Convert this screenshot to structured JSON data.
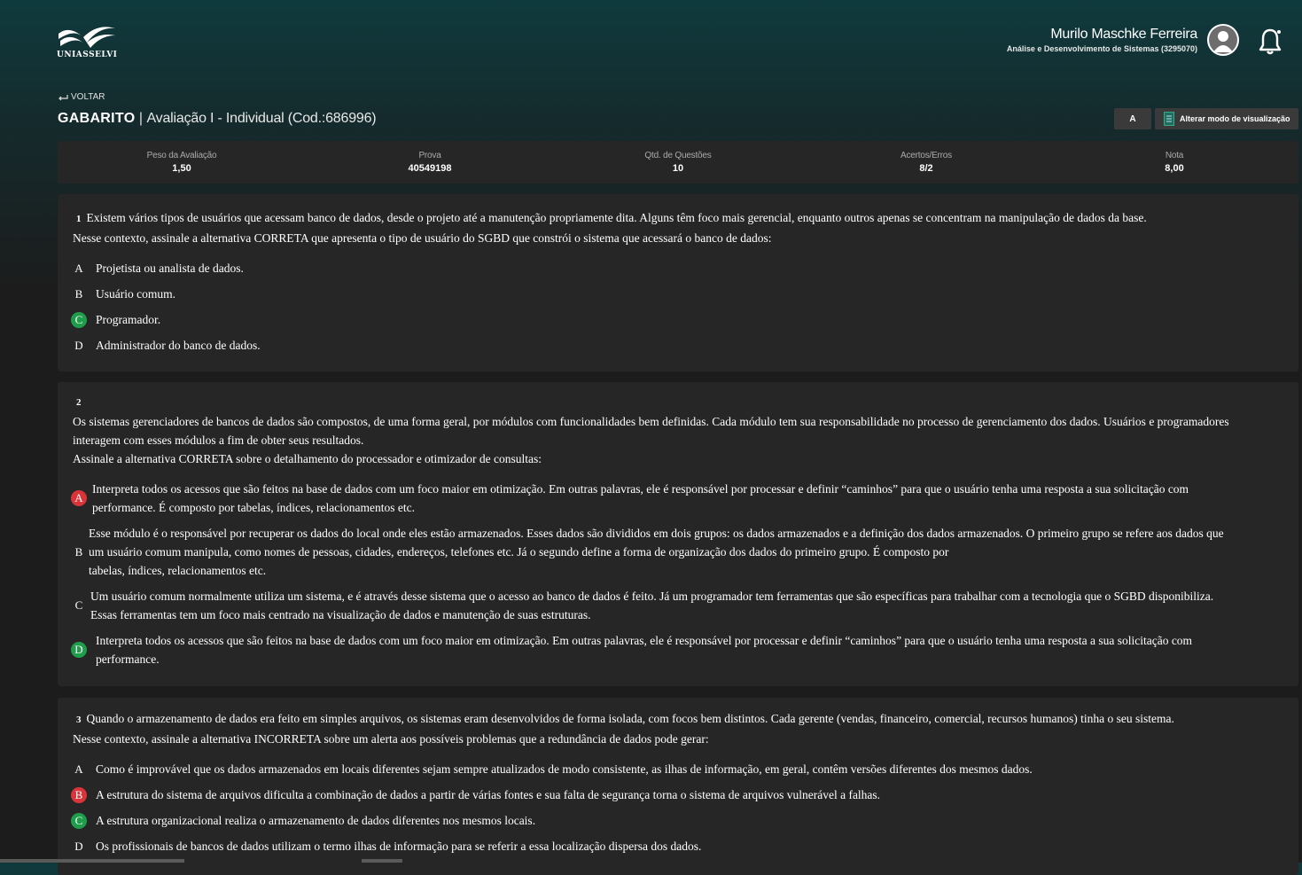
{
  "brand": {
    "name": "UNIASSELVI"
  },
  "user": {
    "name": "Murilo Maschke Ferreira",
    "course": "Análise e Desenvolvimento de Sistemas (3295070)"
  },
  "nav": {
    "back_label": "VOLTAR"
  },
  "header": {
    "title_bold": "GABARITO",
    "title_sep": " | ",
    "title_rest": "Avaliação I - Individual (Cod.:686996)"
  },
  "toolbar": {
    "font_button": "A",
    "view_mode_button": "Alterar modo de visualização"
  },
  "summary": [
    {
      "label": "Peso da Avaliação",
      "value": "1,50"
    },
    {
      "label": "Prova",
      "value": "40549198"
    },
    {
      "label": "Qtd. de Questões",
      "value": "10"
    },
    {
      "label": "Acertos/Erros",
      "value": "8/2"
    },
    {
      "label": "Nota",
      "value": "8,00"
    }
  ],
  "questions": [
    {
      "number": "1",
      "lines": [
        "Existem vários tipos de usuários que acessam banco de dados, desde o projeto até a manutenção propriamente dita. Alguns têm foco mais gerencial, enquanto outros apenas se concentram na manipulação de dados da base.",
        "Nesse contexto, assinale a alternativa CORRETA que apresenta o tipo de usuário do SGBD que constrói o sistema que acessará o banco de dados:"
      ],
      "options": [
        {
          "letter": "A",
          "status": "none",
          "text": "Projetista ou analista de dados."
        },
        {
          "letter": "B",
          "status": "none",
          "text": "Usuário comum."
        },
        {
          "letter": "C",
          "status": "correct",
          "text": "Programador."
        },
        {
          "letter": "D",
          "status": "none",
          "text": "Administrador do banco de dados."
        }
      ]
    },
    {
      "number": "2",
      "lines": [
        "Os sistemas gerenciadores de bancos de dados são compostos, de uma forma geral, por módulos com funcionalidades bem definidas. Cada módulo tem sua responsabilidade no processo de gerenciamento dos dados. Usuários e programadores",
        "interagem com esses módulos a fim de obter seus resultados.",
        "Assinale a alternativa CORRETA sobre o detalhamento do processador e otimizador de consultas:"
      ],
      "options": [
        {
          "letter": "A",
          "status": "wrong",
          "lines": [
            "Interpreta todos os acessos que são feitos na base de dados com um foco maior em otimização. Em outras palavras, ele é responsável por processar e definir “caminhos” para que o usuário tenha uma resposta a sua solicitação com",
            "performance. É composto por tabelas, índices, relacionamentos etc."
          ]
        },
        {
          "letter": "B",
          "status": "none",
          "lines": [
            "Esse módulo é o responsável por recuperar os dados do local onde eles estão armazenados. Esses dados são divididos em dois grupos: os dados armazenados e a definição dos dados armazenados. O primeiro grupo se refere aos dados que",
            "um usuário comum manipula, como nomes de pessoas, cidades, endereços, telefones etc. Já o segundo define a forma de organização dos dados do primeiro grupo. É composto por",
            "tabelas, índices, relacionamentos etc."
          ]
        },
        {
          "letter": "C",
          "status": "none",
          "lines": [
            "Um usuário comum normalmente utiliza um sistema, e é através desse sistema que o acesso ao banco de dados é feito. Já um programador tem ferramentas que são específicas para trabalhar com a tecnologia que o SGBD disponibiliza.",
            "Essas ferramentas tem um foco mais centrado na visualização de dados e manutenção de suas estruturas."
          ]
        },
        {
          "letter": "D",
          "status": "correct",
          "lines": [
            "Interpreta todos os acessos que são feitos na base de dados com um foco maior em otimização. Em outras palavras, ele é responsável por processar e definir “caminhos” para que o usuário tenha uma resposta a sua solicitação com",
            "performance."
          ]
        }
      ]
    },
    {
      "number": "3",
      "lines": [
        "Quando o armazenamento de dados era feito em simples arquivos, os sistemas eram desenvolvidos de forma isolada, com focos bem distintos. Cada gerente (vendas, financeiro, comercial, recursos humanos) tinha o seu sistema.",
        "Nesse contexto, assinale a alternativa INCORRETA sobre um alerta aos possíveis problemas que a redundância de dados pode gerar:"
      ],
      "options": [
        {
          "letter": "A",
          "status": "none",
          "text": "Como é improvável que os dados armazenados em locais diferentes sejam sempre atualizados de modo consistente, as ilhas de informação, em geral, contêm versões diferentes dos mesmos dados."
        },
        {
          "letter": "B",
          "status": "wrong",
          "text": "A estrutura do sistema de arquivos dificulta a combinação de dados a partir de várias fontes e sua falta de segurança torna o sistema de arquivos vulnerável a falhas."
        },
        {
          "letter": "C",
          "status": "correct",
          "text": "A estrutura organizacional realiza o armazenamento de dados diferentes nos mesmos locais."
        },
        {
          "letter": "D",
          "status": "none",
          "text": "Os profissionais de bancos de dados utilizam o termo ilhas de informação para se referir a essa localização dispersa dos dados."
        }
      ]
    }
  ]
}
